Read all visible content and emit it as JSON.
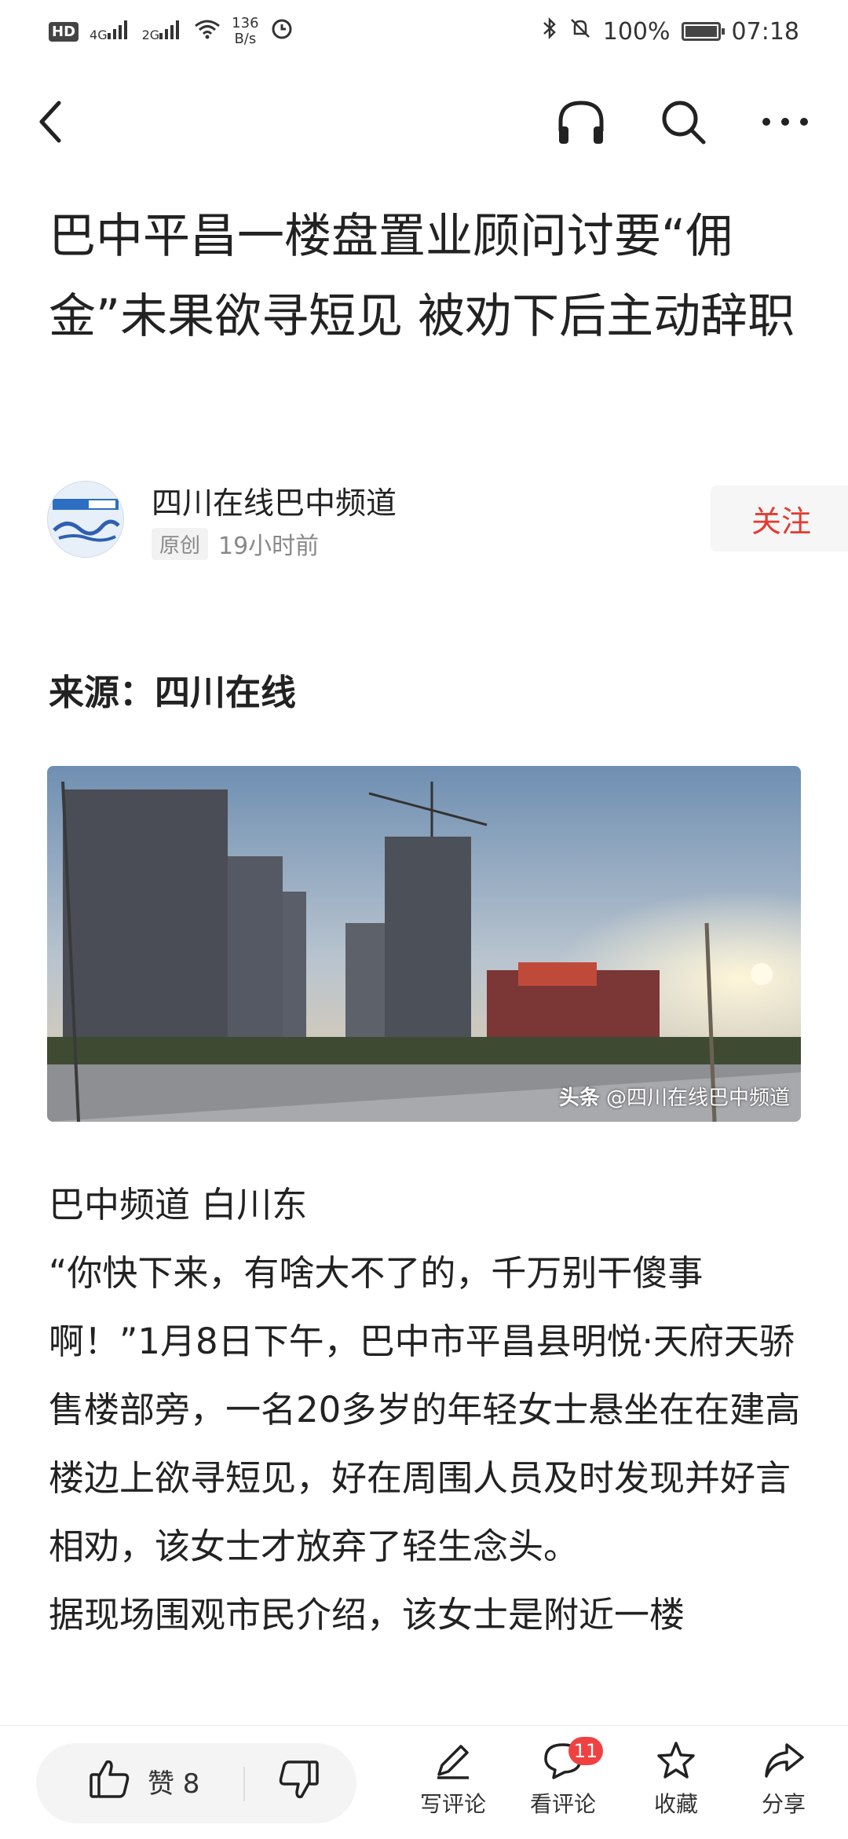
{
  "status_bar": {
    "hd": "HD",
    "sim1": "4G",
    "sim2": "2G",
    "speed_value": "136",
    "speed_unit": "B/s",
    "battery": "100%",
    "time": "07:18"
  },
  "article": {
    "title": "巴中平昌一楼盘置业顾问讨要“佣金”未果欲寻短见 被劝下后主动辞职",
    "author": "四川在线巴中频道",
    "origin_tag": "原创",
    "time_ago": "19小时前",
    "follow_label": "关注",
    "source": "来源：四川在线",
    "photo_watermark_brand": "头条",
    "photo_watermark_handle": "@四川在线巴中频道",
    "paragraphs": [
      "巴中频道 白川东",
      "“你快下来，有啥大不了的，千万别干傻事啊！”1月8日下午，巴中市平昌县明悦·天府天骄售楼部旁，一名20多岁的年轻女士悬坐在在建高楼边上欲寻短见，好在周围人员及时发现并好言相劝，该女士才放弃了轻生念头。",
      "据现场围观市民介绍，该女士是附近一楼"
    ]
  },
  "bottom_bar": {
    "like_label": "赞 8",
    "write_comment": "写评论",
    "view_comments": "看评论",
    "comment_count": "11",
    "favorite": "收藏",
    "share": "分享"
  },
  "icons": {
    "back": "back-arrow-icon",
    "audio": "headphones-icon",
    "search": "search-icon",
    "more": "more-icon"
  }
}
